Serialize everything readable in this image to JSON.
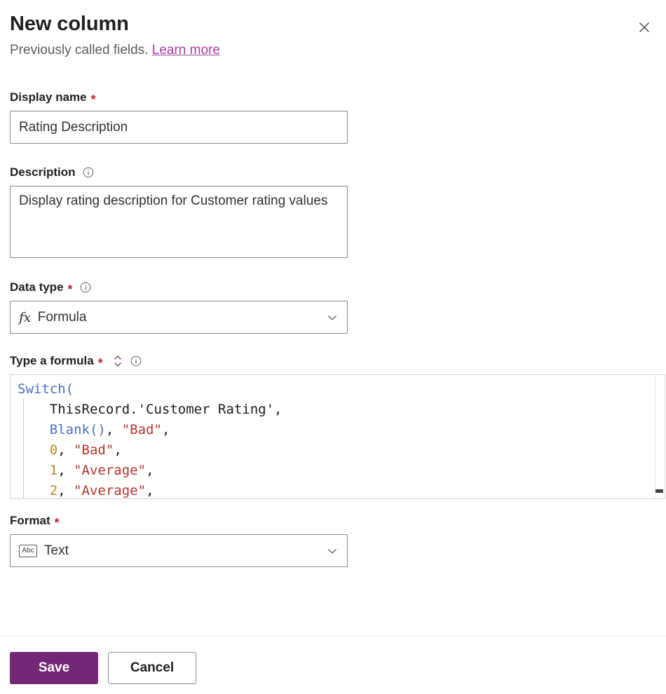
{
  "header": {
    "title": "New column",
    "subtitle_text": "Previously called fields.",
    "link_label": "Learn more",
    "close_icon": "close-icon"
  },
  "fields": {
    "display_name": {
      "label": "Display name",
      "required_marker": "*",
      "value": "Rating Description",
      "placeholder": ""
    },
    "description": {
      "label": "Description",
      "info_icon": "info-icon",
      "value": "Display rating description for Customer rating values",
      "placeholder": ""
    },
    "data_type": {
      "label": "Data type",
      "required_marker": "*",
      "info_icon": "info-icon",
      "icon_label": "fx",
      "selected": "Formula",
      "chevron_icon": "chevron-down-icon"
    },
    "formula": {
      "label": "Type a formula",
      "required_marker": "*",
      "expand_icon": "expand-collapse-icon",
      "info_icon": "info-icon",
      "lines": [
        [
          {
            "t": "Switch(",
            "k": "fn"
          }
        ],
        [
          {
            "t": "    ThisRecord.'Customer Rating',",
            "k": "plain"
          }
        ],
        [
          {
            "t": "    ",
            "k": "plain"
          },
          {
            "t": "Blank()",
            "k": "fn"
          },
          {
            "t": ", ",
            "k": "plain"
          },
          {
            "t": "\"Bad\"",
            "k": "str"
          },
          {
            "t": ",",
            "k": "plain"
          }
        ],
        [
          {
            "t": "    ",
            "k": "plain"
          },
          {
            "t": "0",
            "k": "num"
          },
          {
            "t": ", ",
            "k": "plain"
          },
          {
            "t": "\"Bad\"",
            "k": "str"
          },
          {
            "t": ",",
            "k": "plain"
          }
        ],
        [
          {
            "t": "    ",
            "k": "plain"
          },
          {
            "t": "1",
            "k": "num"
          },
          {
            "t": ", ",
            "k": "plain"
          },
          {
            "t": "\"Average\"",
            "k": "str"
          },
          {
            "t": ",",
            "k": "plain"
          }
        ],
        [
          {
            "t": "    ",
            "k": "plain"
          },
          {
            "t": "2",
            "k": "num"
          },
          {
            "t": ", ",
            "k": "plain"
          },
          {
            "t": "\"Average\"",
            "k": "str"
          },
          {
            "t": ",",
            "k": "plain"
          }
        ]
      ]
    },
    "format": {
      "label": "Format",
      "required_marker": "*",
      "icon_label": "Abc",
      "selected": "Text",
      "chevron_icon": "chevron-down-icon"
    }
  },
  "footer": {
    "save_label": "Save",
    "cancel_label": "Cancel"
  },
  "colors": {
    "accent_purple": "#742774",
    "link_purple": "#a33ea3",
    "required_red": "#b92d2d",
    "token_function": "#4a6fc0",
    "token_string": "#b5352e",
    "token_number": "#c8852b"
  }
}
